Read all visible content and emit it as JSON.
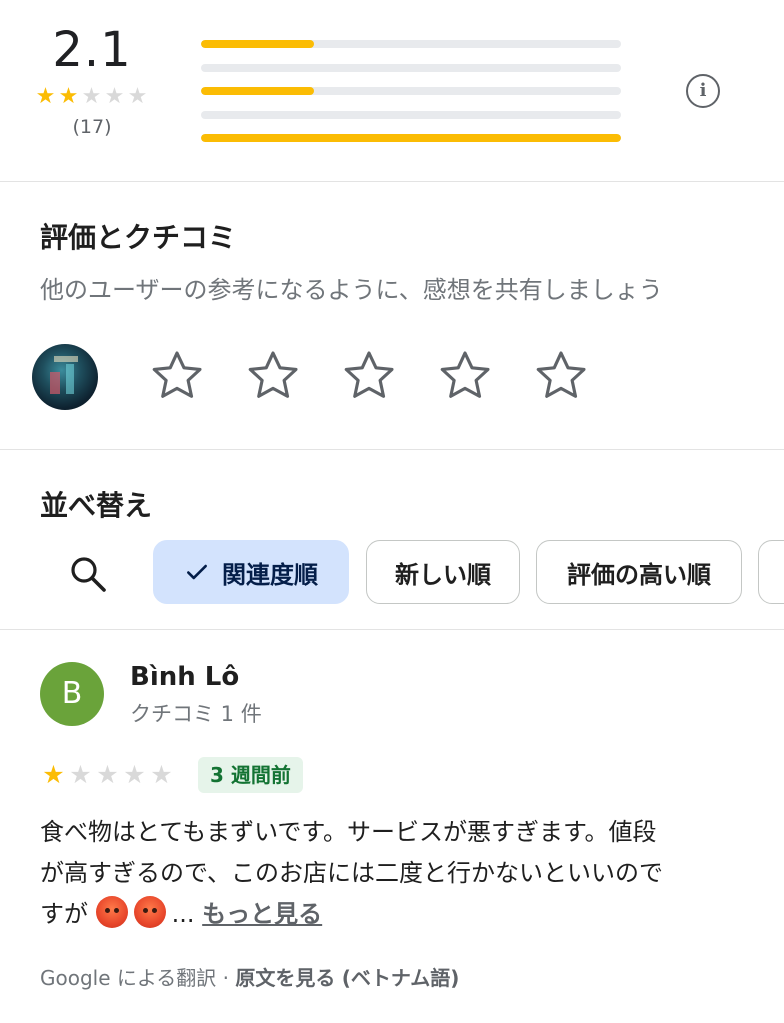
{
  "summary": {
    "average": "2.1",
    "filled_stars": 2,
    "total_stars": 5,
    "count": "(17)",
    "distribution_fraction": [
      0.27,
      0.0,
      0.27,
      0.0,
      1.0
    ],
    "bar_color": "#fbbc04",
    "info_icon": "info-icon"
  },
  "write_review": {
    "title": "評価とクチコミ",
    "subtitle": "他のユーザーの参考になるように、感想を共有しましょう",
    "star_count": 5
  },
  "sort": {
    "title": "並べ替え",
    "search_icon": "search-icon",
    "chips": [
      {
        "label": "関連度順",
        "selected": true
      },
      {
        "label": "新しい順",
        "selected": false
      },
      {
        "label": "評価の高い順",
        "selected": false
      }
    ]
  },
  "review": {
    "avatar_letter": "B",
    "avatar_color": "#6aa33a",
    "name": "Bình Lô",
    "meta": "クチコミ 1 件",
    "rating": 1,
    "date": "3 週間前",
    "text_line1": "食べ物はとてもまずいです。サービスが悪すぎます。値段",
    "text_line2": "が高すぎるので、このお店には二度と行かないといいので",
    "text_line3": "すが",
    "ellipsis": "...",
    "more": "もっと見る",
    "translate_prefix": "Google による翻訳 · ",
    "translate_link": "原文を見る",
    "translate_lang": "(ベトナム語)"
  }
}
